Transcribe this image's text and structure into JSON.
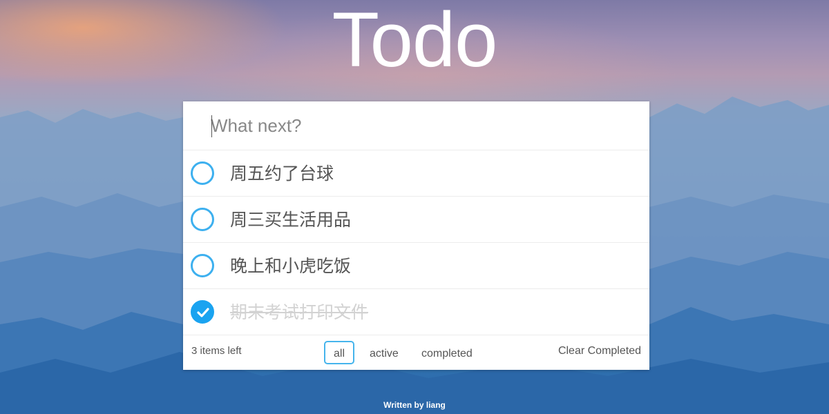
{
  "app": {
    "title": "Todo"
  },
  "input": {
    "placeholder": "What next?",
    "value": ""
  },
  "todos": [
    {
      "text": "周五约了台球",
      "completed": false
    },
    {
      "text": "周三买生活用品",
      "completed": false
    },
    {
      "text": "晚上和小虎吃饭",
      "completed": false
    },
    {
      "text": "期末考试打印文件",
      "completed": true
    }
  ],
  "footer": {
    "items_left": "3 items left",
    "filters": [
      {
        "label": "all",
        "selected": true
      },
      {
        "label": "active",
        "selected": false
      },
      {
        "label": "completed",
        "selected": false
      }
    ],
    "clear_label": "Clear Completed"
  },
  "credit": "Written by liang",
  "colors": {
    "accent": "#1aa3f0",
    "ring": "#3db0ef",
    "filter_border": "#45b4ec"
  }
}
